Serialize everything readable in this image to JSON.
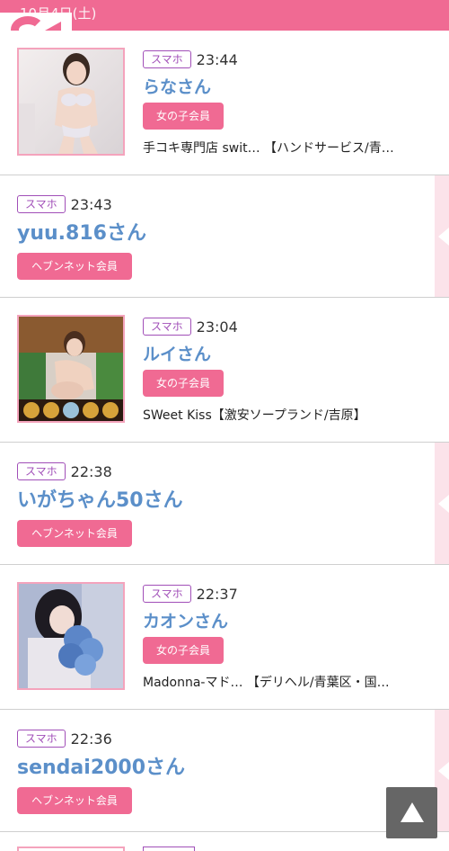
{
  "header": {
    "date": "10月4日(土)",
    "logo_icon": "logo-icon"
  },
  "entries": [
    {
      "device": "スマホ",
      "time": "23:44",
      "name": "らなさん",
      "member_type": "女の子会員",
      "shop": "手コキ専門店 swit… 【ハンドサービス/青…",
      "has_photo": true
    },
    {
      "device": "スマホ",
      "time": "23:43",
      "name": "yuu.816さん",
      "member_type": "ヘブンネット会員",
      "has_photo": false
    },
    {
      "device": "スマホ",
      "time": "23:04",
      "name": "ルイさん",
      "member_type": "女の子会員",
      "shop": "SWeet Kiss【激安ソープランド/吉原】",
      "has_photo": true
    },
    {
      "device": "スマホ",
      "time": "22:38",
      "name": "いがちゃん50さん",
      "member_type": "ヘブンネット会員",
      "has_photo": false
    },
    {
      "device": "スマホ",
      "time": "22:37",
      "name": "カオンさん",
      "member_type": "女の子会員",
      "shop": "Madonna-マド… 【デリヘル/青葉区・国…",
      "has_photo": true
    },
    {
      "device": "スマホ",
      "time": "22:36",
      "name": "sendai2000さん",
      "member_type": "ヘブンネット会員",
      "has_photo": false
    }
  ],
  "scroll_top_icon": "arrow-up-icon",
  "colors": {
    "accent": "#f06a93",
    "name": "#5b8fc9",
    "device_badge": "#a14fb8"
  }
}
